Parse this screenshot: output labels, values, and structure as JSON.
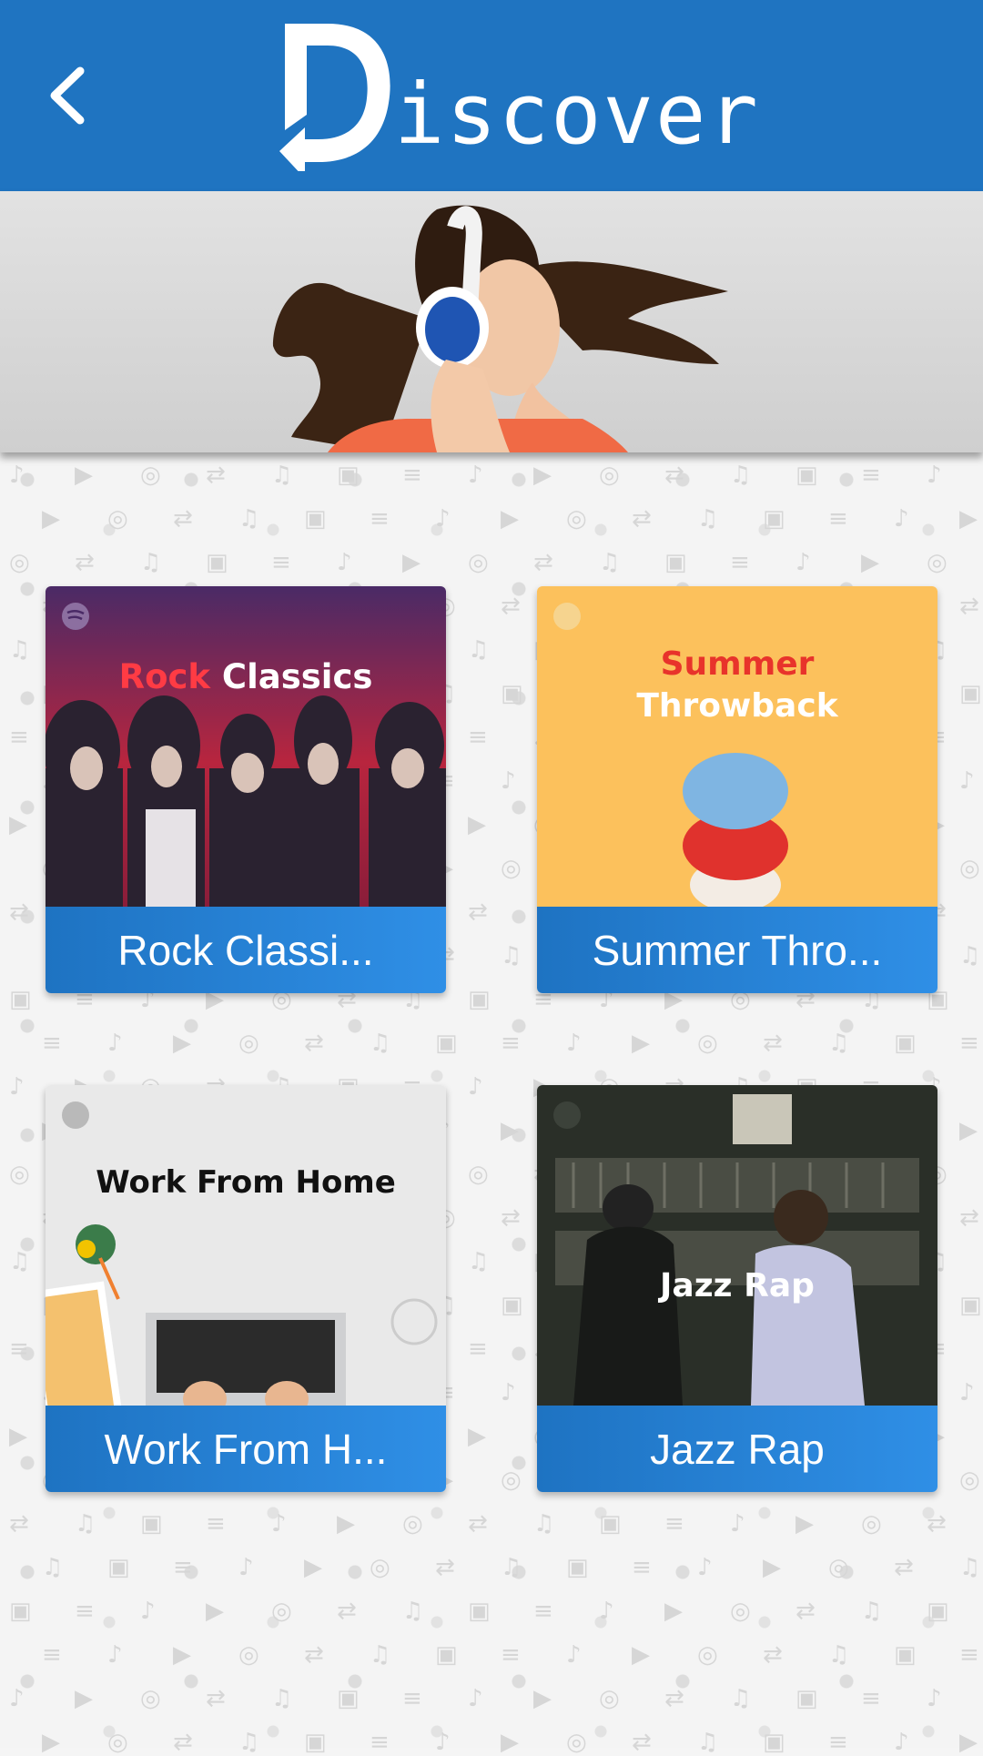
{
  "header": {
    "logo_initial": "D",
    "logo_rest": "iscover",
    "back_icon": "chevron-left-icon"
  },
  "banner": {
    "subject": "girl-with-headphones"
  },
  "playlists": [
    {
      "art_title_part1": "Rock",
      "art_title_part2": "Classics",
      "label": "Rock Classi..."
    },
    {
      "art_title_line1": "Summer",
      "art_title_line2": "Throwback",
      "label": "Summer Thro..."
    },
    {
      "art_title": "Work From Home",
      "label": "Work From H..."
    },
    {
      "art_title": "Jazz Rap",
      "label": "Jazz Rap"
    }
  ],
  "colors": {
    "primary": "#1f74c1",
    "label_gradient_start": "#1e73c2",
    "label_gradient_end": "#2f8fe6",
    "rock_bg_top": "#4a2a66",
    "rock_bg_bottom": "#b8253e",
    "summer_bg": "#fcc15c",
    "summer_red": "#e8332b",
    "wfh_bg": "#e9e9e9",
    "jazz_bg": "#2a2f28"
  }
}
